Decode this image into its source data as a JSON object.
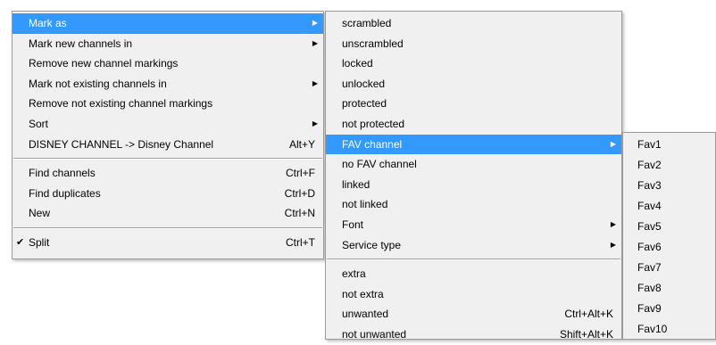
{
  "menu_main": {
    "items": [
      {
        "label": "Mark as",
        "shortcut": "",
        "submenu": true
      },
      {
        "label": "Mark new channels in",
        "shortcut": "",
        "submenu": true
      },
      {
        "label": "Remove new channel markings",
        "shortcut": "",
        "submenu": false
      },
      {
        "label": "Mark not existing channels in",
        "shortcut": "",
        "submenu": true
      },
      {
        "label": "Remove not existing channel markings",
        "shortcut": "",
        "submenu": false
      },
      {
        "label": "Sort",
        "shortcut": "",
        "submenu": true
      },
      {
        "label": "DISNEY CHANNEL -> Disney Channel",
        "shortcut": "Alt+Y",
        "submenu": false
      },
      {
        "label": "Find channels",
        "shortcut": "Ctrl+F",
        "submenu": false
      },
      {
        "label": "Find duplicates",
        "shortcut": "Ctrl+D",
        "submenu": false
      },
      {
        "label": "New",
        "shortcut": "Ctrl+N",
        "submenu": false
      },
      {
        "label": "Split",
        "shortcut": "Ctrl+T",
        "submenu": false,
        "checked": true
      }
    ]
  },
  "menu_mark_as": {
    "items": [
      {
        "label": "scrambled",
        "shortcut": ""
      },
      {
        "label": "unscrambled",
        "shortcut": ""
      },
      {
        "label": "locked",
        "shortcut": ""
      },
      {
        "label": "unlocked",
        "shortcut": ""
      },
      {
        "label": "protected",
        "shortcut": ""
      },
      {
        "label": "not protected",
        "shortcut": ""
      },
      {
        "label": "FAV channel",
        "shortcut": "",
        "submenu": true
      },
      {
        "label": "no FAV channel",
        "shortcut": ""
      },
      {
        "label": "linked",
        "shortcut": ""
      },
      {
        "label": "not linked",
        "shortcut": ""
      },
      {
        "label": "Font",
        "shortcut": "",
        "submenu": true
      },
      {
        "label": "Service type",
        "shortcut": "",
        "submenu": true
      },
      {
        "label": "extra",
        "shortcut": ""
      },
      {
        "label": "not extra",
        "shortcut": ""
      },
      {
        "label": "unwanted",
        "shortcut": "Ctrl+Alt+K"
      },
      {
        "label": "not unwanted",
        "shortcut": "Shift+Alt+K"
      }
    ]
  },
  "menu_fav": {
    "items": [
      "Fav1",
      "Fav2",
      "Fav3",
      "Fav4",
      "Fav5",
      "Fav6",
      "Fav7",
      "Fav8",
      "Fav9",
      "Fav10"
    ]
  },
  "colors": {
    "highlight": "#3399ff",
    "menu_bg": "#f0f0f0"
  },
  "icons": {
    "submenu_arrow": "triangle-right-icon",
    "check": "check-icon"
  }
}
